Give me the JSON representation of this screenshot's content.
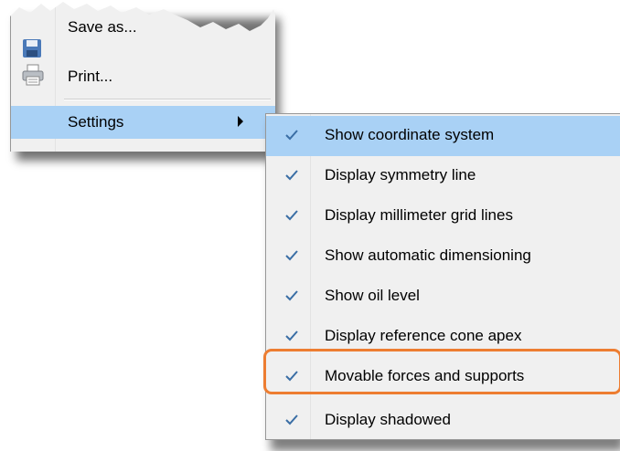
{
  "parent_menu": {
    "items": [
      {
        "label": "Save as...",
        "icon": "save-icon"
      },
      {
        "label": "Print...",
        "icon": "printer-icon"
      },
      {
        "label": "Settings",
        "icon": "chevron-right-icon"
      }
    ]
  },
  "submenu": {
    "items": [
      {
        "label": "Show coordinate system",
        "checked": true
      },
      {
        "label": "Display symmetry line",
        "checked": true
      },
      {
        "label": "Display millimeter grid lines",
        "checked": true
      },
      {
        "label": "Show automatic dimensioning",
        "checked": true
      },
      {
        "label": "Show oil level",
        "checked": true
      },
      {
        "label": "Display reference cone apex",
        "checked": true
      },
      {
        "label": "Movable forces and supports",
        "checked": true
      },
      {
        "label": "Display shadowed",
        "checked": true
      }
    ]
  },
  "colors": {
    "highlight": "#a9d1f5",
    "menu_bg": "#f0f0f0",
    "check": "#3a6ea5",
    "callout": "#ed7d31"
  }
}
